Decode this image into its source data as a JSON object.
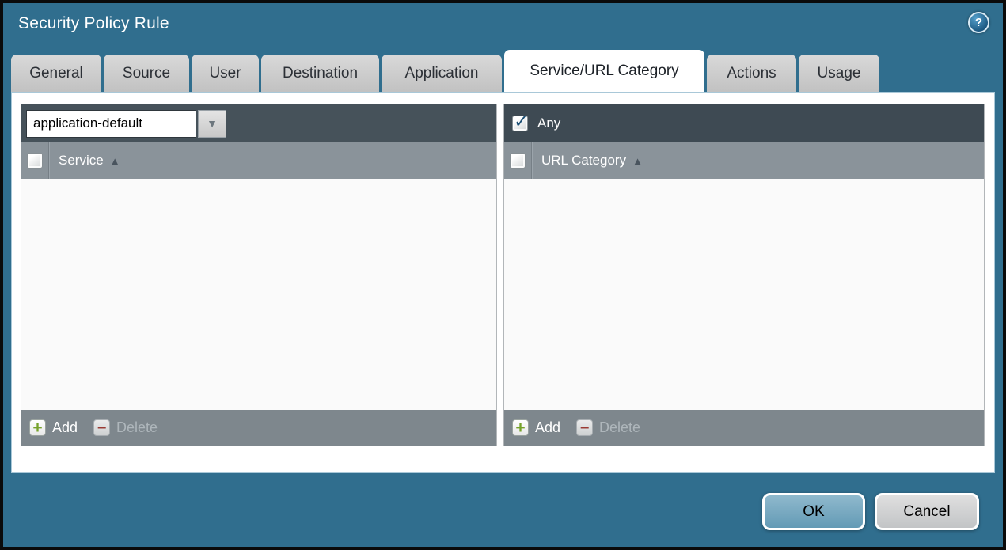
{
  "dialog": {
    "title": "Security Policy Rule"
  },
  "icons": {
    "help": "?",
    "dropdown_arrow": "▼",
    "sort_ascending": "▲",
    "checkmark": "✓",
    "add_plus": "+",
    "delete_minus": "−"
  },
  "tabs": [
    {
      "label": "General",
      "active": false
    },
    {
      "label": "Source",
      "active": false
    },
    {
      "label": "User",
      "active": false
    },
    {
      "label": "Destination",
      "active": false
    },
    {
      "label": "Application",
      "active": false
    },
    {
      "label": "Service/URL Category",
      "active": true
    },
    {
      "label": "Actions",
      "active": false
    },
    {
      "label": "Usage",
      "active": false
    }
  ],
  "service_panel": {
    "selector_value": "application-default",
    "column_header": "Service",
    "select_all_checked": false,
    "rows": [],
    "add_label": "Add",
    "delete_label": "Delete",
    "delete_enabled": false
  },
  "url_category_panel": {
    "any_label": "Any",
    "any_checked": true,
    "column_header": "URL Category",
    "select_all_checked": false,
    "rows": [],
    "add_label": "Add",
    "delete_label": "Delete",
    "delete_enabled": false
  },
  "actions": {
    "ok_label": "OK",
    "cancel_label": "Cancel"
  },
  "colors": {
    "dialog_background": "#306E8E",
    "tab_background": "#C9C9C9",
    "active_tab_background": "#FFFFFF",
    "panel_toolbar_background": "#46525A",
    "any_bar_background": "#3E4A53",
    "column_header_background": "#8A939A",
    "panel_footer_background": "#7E878D",
    "list_background": "#FAFAFA",
    "add_icon_green": "#76A22A",
    "delete_icon_red": "#9A3A33",
    "checkmark_blue": "#1C4F74",
    "ok_button_background": "#6FA5BF",
    "cancel_button_background": "#C9CBCC"
  }
}
